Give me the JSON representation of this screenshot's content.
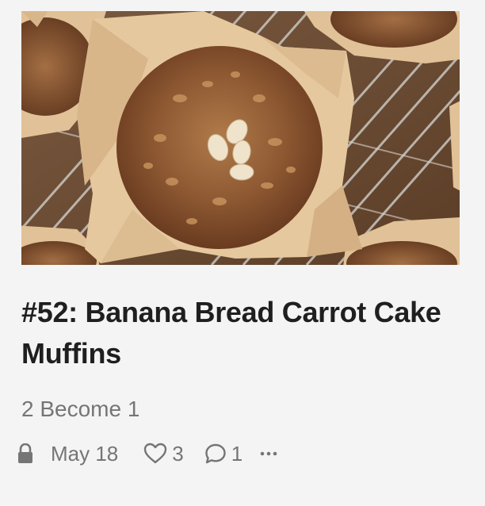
{
  "post": {
    "title": "#52: Banana Bread Carrot Cake Muffins",
    "subtitle": "2 Become 1",
    "date": "May 18",
    "likes": "3",
    "comments": "1"
  },
  "icons": {
    "lock": "lock-icon",
    "like": "heart-icon",
    "comment": "comment-bubble-icon",
    "more": "more-dots-icon"
  },
  "colors": {
    "background": "#f4f4f4",
    "title": "#1f1f1f",
    "meta": "#757575"
  }
}
